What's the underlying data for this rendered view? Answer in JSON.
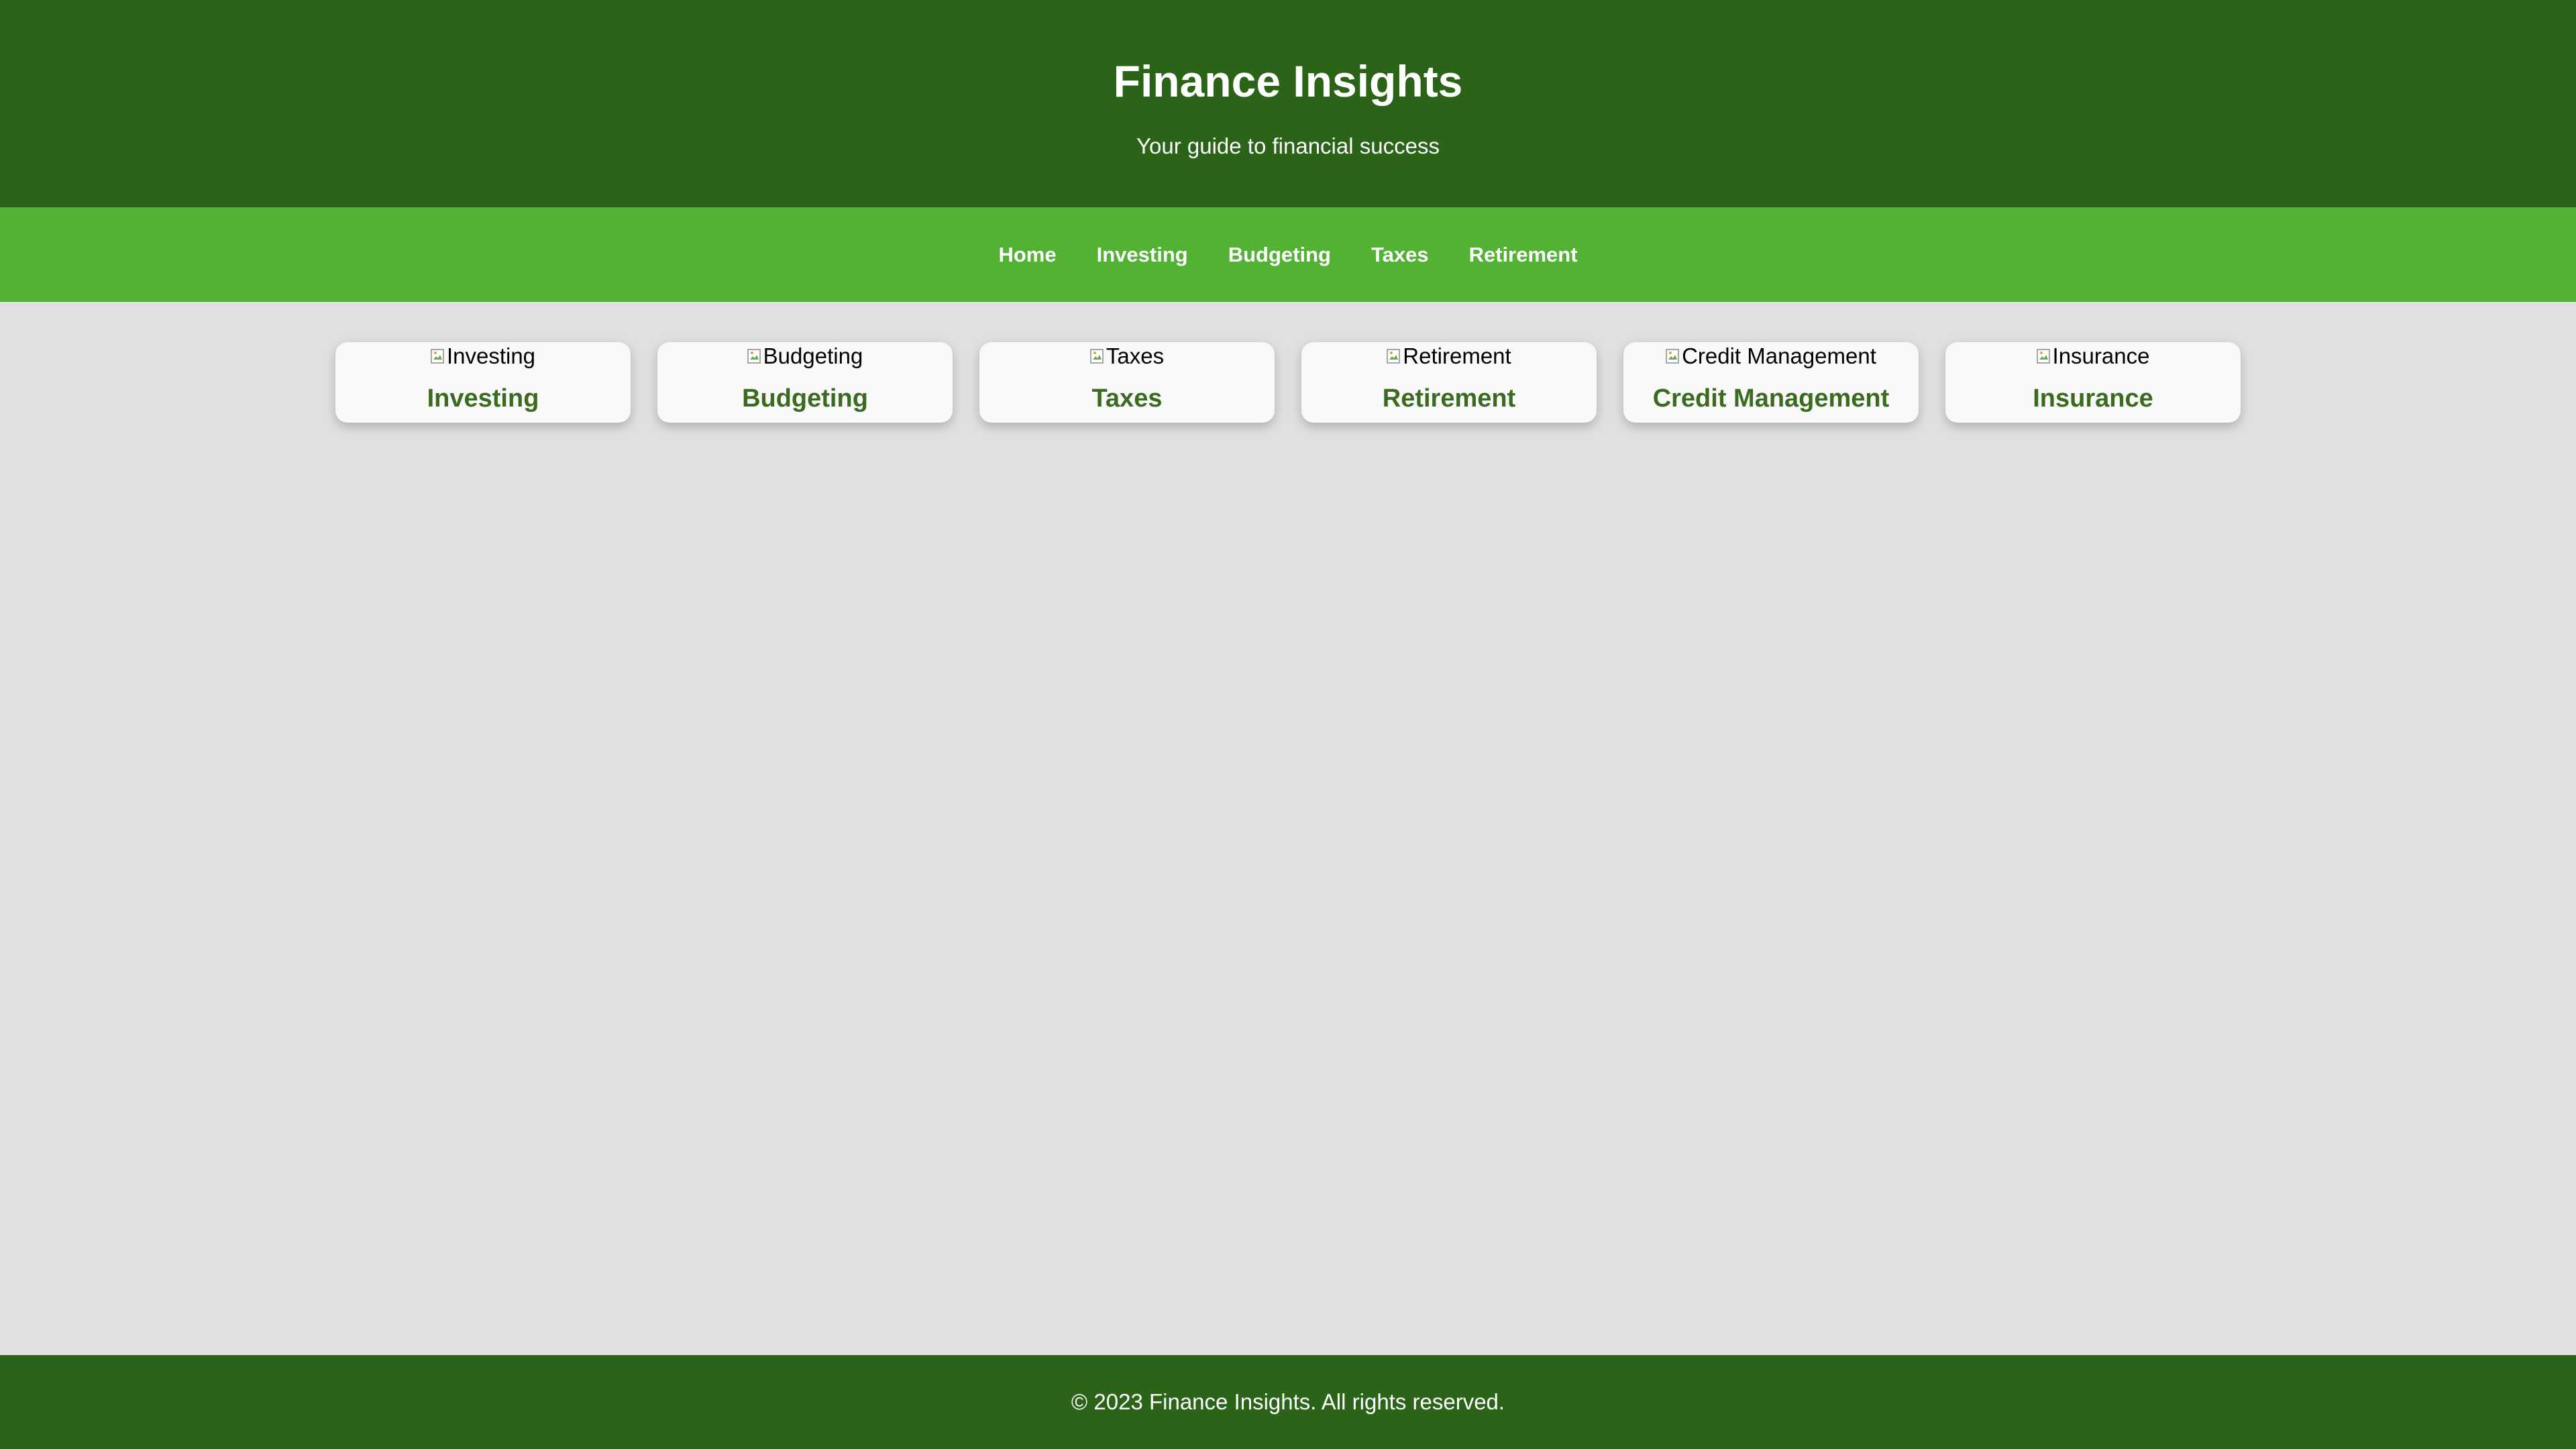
{
  "header": {
    "title": "Finance Insights",
    "tagline": "Your guide to financial success"
  },
  "nav": {
    "items": [
      {
        "label": "Home"
      },
      {
        "label": "Investing"
      },
      {
        "label": "Budgeting"
      },
      {
        "label": "Taxes"
      },
      {
        "label": "Retirement"
      }
    ]
  },
  "cards": [
    {
      "image_alt": "Investing",
      "title": "Investing"
    },
    {
      "image_alt": "Budgeting",
      "title": "Budgeting"
    },
    {
      "image_alt": "Taxes",
      "title": "Taxes"
    },
    {
      "image_alt": "Retirement",
      "title": "Retirement"
    },
    {
      "image_alt": "Credit Management",
      "title": "Credit Management"
    },
    {
      "image_alt": "Insurance",
      "title": "Insurance"
    }
  ],
  "footer": {
    "text": "© 2023 Finance Insights. All rights reserved."
  },
  "colors": {
    "header_bg": "#2b6419",
    "nav_bg": "#52b234",
    "page_bg": "#e0e0e0",
    "card_bg": "#f9f9f9",
    "card_title": "#3a6b1f"
  },
  "icons": {
    "card_image_placeholder": "broken-image-icon"
  }
}
